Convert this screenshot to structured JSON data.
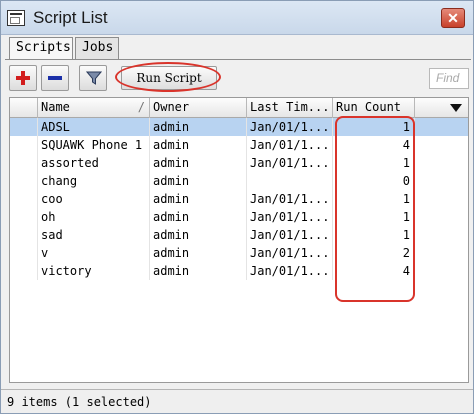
{
  "window": {
    "title": "Script List",
    "close_label": "✕"
  },
  "tabs": [
    {
      "label": "Scripts",
      "active": true
    },
    {
      "label": "Jobs",
      "active": false
    }
  ],
  "toolbar": {
    "add_icon": "plus-icon",
    "remove_icon": "minus-icon",
    "filter_icon": "funnel-icon",
    "run_label": "Run Script",
    "find_placeholder": "Find"
  },
  "table": {
    "columns": {
      "name": "Name",
      "owner": "Owner",
      "last": "Last Tim...",
      "count": "Run Count"
    },
    "sort_mark": "/",
    "rows": [
      {
        "name": "ADSL",
        "owner": "admin",
        "last": "Jan/01/1...",
        "count": "1"
      },
      {
        "name": "SQUAWK Phone 1",
        "owner": "admin",
        "last": "Jan/01/1...",
        "count": "4"
      },
      {
        "name": "assorted",
        "owner": "admin",
        "last": "Jan/01/1...",
        "count": "1"
      },
      {
        "name": "chang",
        "owner": "admin",
        "last": "",
        "count": "0"
      },
      {
        "name": "coo",
        "owner": "admin",
        "last": "Jan/01/1...",
        "count": "1"
      },
      {
        "name": "oh",
        "owner": "admin",
        "last": "Jan/01/1...",
        "count": "1"
      },
      {
        "name": "sad",
        "owner": "admin",
        "last": "Jan/01/1...",
        "count": "1"
      },
      {
        "name": "v",
        "owner": "admin",
        "last": "Jan/01/1...",
        "count": "2"
      },
      {
        "name": "victory",
        "owner": "admin",
        "last": "Jan/01/1...",
        "count": "4"
      }
    ],
    "selected_row": 0
  },
  "status": {
    "text": "9 items (1 selected)"
  },
  "colors": {
    "selection": "#b8d3f1",
    "annotation": "#d9342b",
    "add": "#d21d1d",
    "remove": "#1b2fa8"
  }
}
